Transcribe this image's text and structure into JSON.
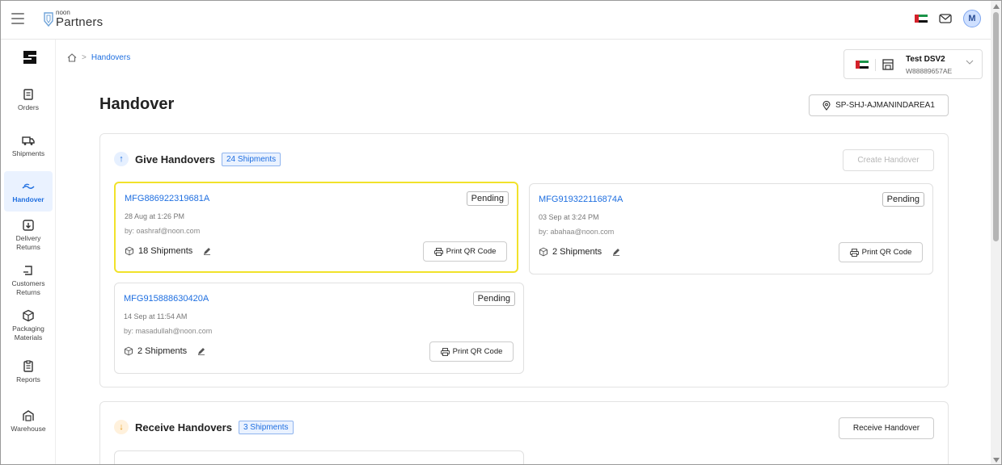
{
  "topbar": {
    "logo_small": "noon",
    "logo_main": "Partners",
    "avatar_initial": "M"
  },
  "sidebar": {
    "items": [
      {
        "label": "Orders",
        "icon": "orders-icon"
      },
      {
        "label": "Shipments",
        "icon": "truck-icon"
      },
      {
        "label": "Handover",
        "icon": "handover-icon",
        "active": true
      },
      {
        "label": "Delivery Returns",
        "icon": "delivery-returns-icon"
      },
      {
        "label": "Customers Returns",
        "icon": "customer-returns-icon"
      },
      {
        "label": "Packaging Materials",
        "icon": "package-icon"
      },
      {
        "label": "Reports",
        "icon": "reports-icon"
      },
      {
        "label": "Warehouse",
        "icon": "warehouse-icon"
      }
    ]
  },
  "breadcrumb": {
    "current": "Handovers"
  },
  "store": {
    "name": "Test DSV2",
    "id": "W88889657AE"
  },
  "page": {
    "title": "Handover",
    "location": "SP-SHJ-AJMANINDAREA1"
  },
  "give": {
    "title": "Give Handovers",
    "count": "24 Shipments",
    "create_label": "Create Handover",
    "cards": [
      {
        "id": "MFG886922319681A",
        "status": "Pending",
        "date": "28 Aug at 1:26 PM",
        "by": "by: oashraf@noon.com",
        "shipments": "18 Shipments",
        "print": "Print QR Code"
      },
      {
        "id": "MFG919322116874A",
        "status": "Pending",
        "date": "03 Sep at 3:24 PM",
        "by": "by: abahaa@noon.com",
        "shipments": "2 Shipments",
        "print": "Print QR Code"
      },
      {
        "id": "MFG915888630420A",
        "status": "Pending",
        "date": "14 Sep at 11:54 AM",
        "by": "by: masadullah@noon.com",
        "shipments": "2 Shipments",
        "print": "Print QR Code"
      }
    ]
  },
  "receive": {
    "title": "Receive Handovers",
    "count": "3 Shipments",
    "receive_label": "Receive Handover"
  },
  "colors": {
    "accent": "#1f6fe0",
    "highlight": "#f1e22a",
    "flag_red": "#d4212a",
    "flag_green": "#1a9448"
  }
}
